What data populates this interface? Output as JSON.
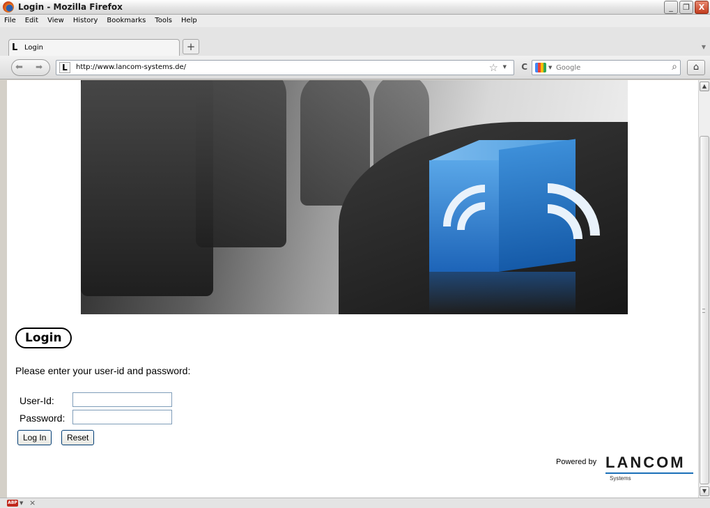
{
  "window": {
    "title": "Login - Mozilla Firefox",
    "minimize": "_",
    "restore": "❐",
    "close": "X"
  },
  "menu": [
    "File",
    "Edit",
    "View",
    "History",
    "Bookmarks",
    "Tools",
    "Help"
  ],
  "tab": {
    "title": "Login",
    "favicon": "L",
    "new_tab": "+"
  },
  "nav": {
    "url": "http://www.lancom-systems.de/",
    "search_placeholder": "Google",
    "site_icon": "L"
  },
  "page": {
    "heading": "Login",
    "prompt": "Please enter your user-id and password:",
    "userid_label": "User-Id:",
    "password_label": "Password:",
    "userid_value": "",
    "password_value": "",
    "login_button": "Log In",
    "reset_button": "Reset",
    "powered_by": "Powered by",
    "brand": "LANCOM",
    "brand_sub": "Systems"
  },
  "statusbar": {
    "abp_label": "ABP"
  },
  "colors": {
    "brand_blue": "#1a6fb8",
    "cube_blue": "#1d64b8",
    "close_red": "#c33c1e"
  }
}
